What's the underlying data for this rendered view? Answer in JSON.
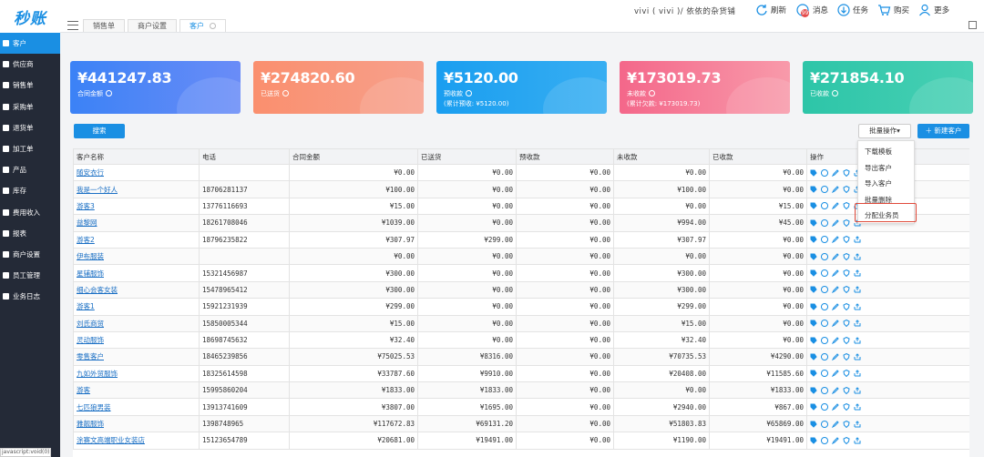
{
  "app": {
    "logo_text": "秒账"
  },
  "header": {
    "tabs": [
      {
        "label": "销售单"
      },
      {
        "label": "商户设置"
      },
      {
        "label": "客户"
      }
    ],
    "shop_info": "vivi ( vivi )/ 依依的杂货铺",
    "tools": {
      "refresh": "刷新",
      "messages": "消息",
      "messages_badge": "99",
      "tasks": "任务",
      "buy": "购买",
      "more": "更多"
    }
  },
  "sidebar": {
    "items": [
      {
        "label": "客户",
        "icon": "users-icon"
      },
      {
        "label": "供应商",
        "icon": "supplier-icon"
      },
      {
        "label": "销售单",
        "icon": "tag-icon"
      },
      {
        "label": "采购单",
        "icon": "cart-icon"
      },
      {
        "label": "退货单",
        "icon": "return-icon"
      },
      {
        "label": "加工单",
        "icon": "process-icon"
      },
      {
        "label": "产品",
        "icon": "gift-icon"
      },
      {
        "label": "库存",
        "icon": "warehouse-icon"
      },
      {
        "label": "费用收入",
        "icon": "money-icon"
      },
      {
        "label": "报表",
        "icon": "pie-chart-icon"
      },
      {
        "label": "商户设置",
        "icon": "gear-icon"
      },
      {
        "label": "员工管理",
        "icon": "staff-icon"
      },
      {
        "label": "业务日志",
        "icon": "log-icon"
      }
    ]
  },
  "status_bar": "javascript:void(0)",
  "cards": [
    {
      "amount": "¥441247.83",
      "label": "合同金额",
      "sub": ""
    },
    {
      "amount": "¥274820.60",
      "label": "已送货",
      "sub": ""
    },
    {
      "amount": "¥5120.00",
      "label": "预收款",
      "sub": "(累计预收: ¥5120.00)"
    },
    {
      "amount": "¥173019.73",
      "label": "未收款",
      "sub": "(累计欠款: ¥173019.73)"
    },
    {
      "amount": "¥271854.10",
      "label": "已收款",
      "sub": ""
    }
  ],
  "toolbar": {
    "search": "搜索",
    "batch": "批量操作▾",
    "new_customer": "＋ 新建客户"
  },
  "dropdown": {
    "items": [
      "下载模板",
      "导出客户",
      "导入客户",
      "批量删除",
      "分配业务员"
    ]
  },
  "table": {
    "headers": [
      "客户名称",
      "电话",
      "合同金额",
      "已送货",
      "预收款",
      "未收款",
      "已收款",
      "操作"
    ],
    "rows": [
      [
        "随安衣行",
        "",
        "¥0.00",
        "¥0.00",
        "¥0.00",
        "¥0.00",
        "¥0.00"
      ],
      [
        "我是一个好人",
        "18706281137",
        "¥100.00",
        "¥0.00",
        "¥0.00",
        "¥100.00",
        "¥0.00"
      ],
      [
        "游客3",
        "13776116693",
        "¥15.00",
        "¥0.00",
        "¥0.00",
        "¥0.00",
        "¥15.00"
      ],
      [
        "益黎网",
        "18261708046",
        "¥1039.00",
        "¥0.00",
        "¥0.00",
        "¥994.00",
        "¥45.00"
      ],
      [
        "游客2",
        "18796235822",
        "¥307.97",
        "¥299.00",
        "¥0.00",
        "¥307.97",
        "¥0.00"
      ],
      [
        "伊布服装",
        "",
        "¥0.00",
        "¥0.00",
        "¥0.00",
        "¥0.00",
        "¥0.00"
      ],
      [
        "星辅服饰",
        "15321456987",
        "¥300.00",
        "¥0.00",
        "¥0.00",
        "¥300.00",
        "¥0.00"
      ],
      [
        "细心会客女装",
        "15478965412",
        "¥300.00",
        "¥0.00",
        "¥0.00",
        "¥300.00",
        "¥0.00"
      ],
      [
        "游客1",
        "15921231939",
        "¥299.00",
        "¥0.00",
        "¥0.00",
        "¥299.00",
        "¥0.00"
      ],
      [
        "刘氏商贸",
        "15850005344",
        "¥15.00",
        "¥0.00",
        "¥0.00",
        "¥15.00",
        "¥0.00"
      ],
      [
        "灵动服饰",
        "18698745632",
        "¥32.40",
        "¥0.00",
        "¥0.00",
        "¥32.40",
        "¥0.00"
      ],
      [
        "零售客户",
        "18465239856",
        "¥75025.53",
        "¥8316.00",
        "¥0.00",
        "¥70735.53",
        "¥4290.00"
      ],
      [
        "九如外贸服饰",
        "18325614598",
        "¥33787.60",
        "¥9910.00",
        "¥0.00",
        "¥20408.00",
        "¥11585.60"
      ],
      [
        "游客",
        "15995860204",
        "¥1833.00",
        "¥1833.00",
        "¥0.00",
        "¥0.00",
        "¥1833.00"
      ],
      [
        "七匹狼男装",
        "13913741609",
        "¥3807.00",
        "¥1695.00",
        "¥0.00",
        "¥2940.00",
        "¥867.00"
      ],
      [
        "雅靓服饰",
        "1398748965",
        "¥117672.83",
        "¥69131.20",
        "¥0.00",
        "¥51803.83",
        "¥65869.00"
      ],
      [
        "涂赛文高端职业女装店",
        "15123654789",
        "¥20681.00",
        "¥19491.00",
        "¥0.00",
        "¥1190.00",
        "¥19491.00"
      ]
    ]
  }
}
